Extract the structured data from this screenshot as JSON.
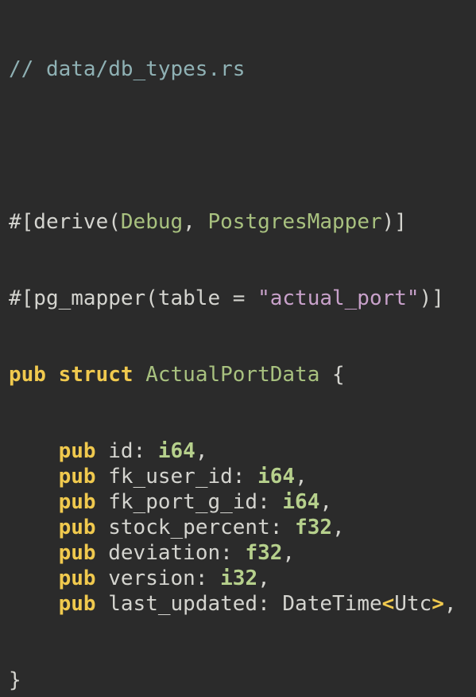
{
  "file_comment": "// data/db_types.rs",
  "derive_attr": {
    "open": "#[derive(",
    "trait1": "Debug",
    "sep": ", ",
    "trait2": "PostgresMapper",
    "close": ")]"
  },
  "mapper_attr": {
    "open": "#[pg_mapper(table = ",
    "value": "\"actual_port\"",
    "close": ")]"
  },
  "struct_decl": {
    "pub": "pub",
    "struct": "struct",
    "name": "ActualPortData",
    "brace": "{"
  },
  "fields": [
    {
      "pub": "pub",
      "name": "id",
      "type": "i64",
      "type_kind": "prim"
    },
    {
      "pub": "pub",
      "name": "fk_user_id",
      "type": "i64",
      "type_kind": "prim"
    },
    {
      "pub": "pub",
      "name": "fk_port_g_id",
      "type": "i64",
      "type_kind": "prim"
    },
    {
      "pub": "pub",
      "name": "stock_percent",
      "type": "f32",
      "type_kind": "prim"
    },
    {
      "pub": "pub",
      "name": "deviation",
      "type": "f32",
      "type_kind": "prim"
    },
    {
      "pub": "pub",
      "name": "version",
      "type": "i32",
      "type_kind": "prim"
    },
    {
      "pub": "pub",
      "name": "last_updated",
      "type": "DateTime",
      "type_kind": "generic",
      "type_param": "Utc"
    }
  ],
  "closing_brace": "}",
  "colors": {
    "background": "#2b2b2b",
    "comment": "#8fb1b4",
    "keyword": "#f0c94e",
    "type": "#a8c17f",
    "primitive": "#b6d08c",
    "string": "#c8a1ca",
    "text": "#d4d4cf"
  }
}
